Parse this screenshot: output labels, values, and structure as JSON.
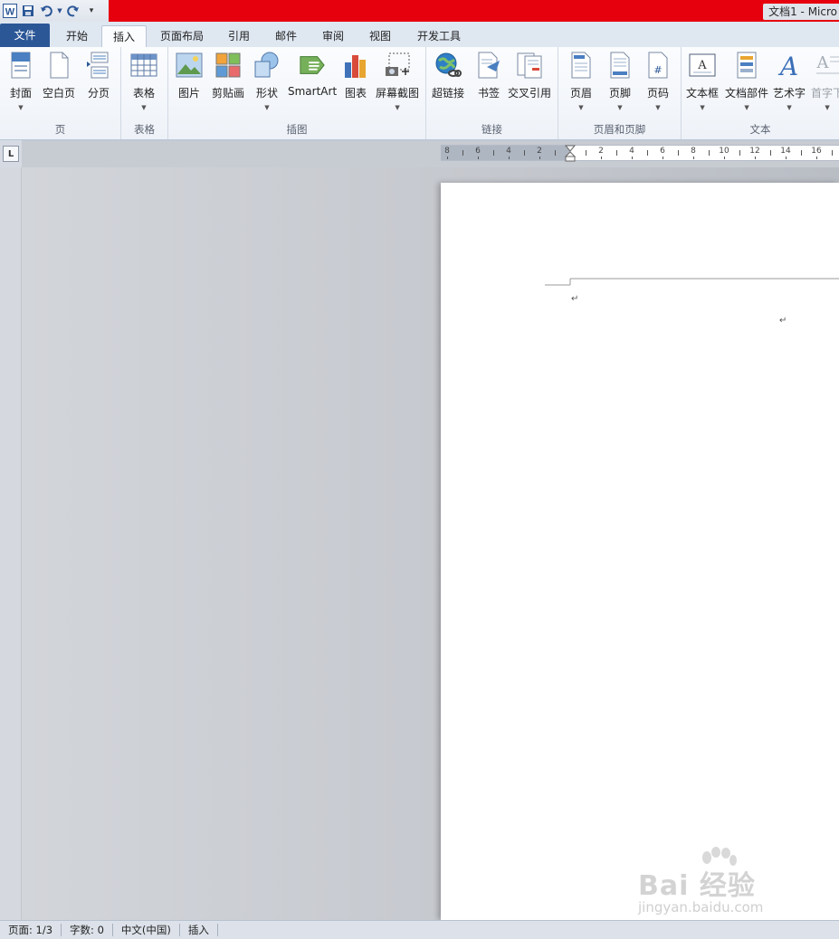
{
  "titlebar": {
    "document_title": "文档1 - Micro"
  },
  "tabs": {
    "file": "文件",
    "home": "开始",
    "insert": "插入",
    "page_layout": "页面布局",
    "references": "引用",
    "mailings": "邮件",
    "review": "审阅",
    "view": "视图",
    "developer": "开发工具"
  },
  "ribbon": {
    "pages_group": {
      "label": "页",
      "cover": "封面",
      "blank_page": "空白页",
      "page_break": "分页"
    },
    "tables_group": {
      "label": "表格",
      "table": "表格"
    },
    "illustrations_group": {
      "label": "插图",
      "picture": "图片",
      "clip_art": "剪贴画",
      "shapes": "形状",
      "smartart": "SmartArt",
      "chart": "图表",
      "screenshot": "屏幕截图"
    },
    "links_group": {
      "label": "链接",
      "hyperlink": "超链接",
      "bookmark": "书签",
      "cross_reference": "交叉引用"
    },
    "header_footer_group": {
      "label": "页眉和页脚",
      "header": "页眉",
      "footer": "页脚",
      "page_number": "页码"
    },
    "text_group": {
      "label": "文本",
      "text_box": "文本框",
      "quick_parts": "文档部件",
      "wordart": "艺术字",
      "drop_cap": "首字下"
    }
  },
  "ruler": {
    "ticks": [
      "8",
      "6",
      "4",
      "2",
      "2",
      "4",
      "6",
      "8",
      "10",
      "12",
      "14",
      "16"
    ]
  },
  "document": {
    "paragraph_mark": "↵"
  },
  "statusbar": {
    "page": "页面: 1/3",
    "word_count": "字数: 0",
    "language": "中文(中国)",
    "mode": "插入"
  },
  "watermark": {
    "logo": "Bai 经验",
    "url": "jingyan.baidu.com"
  },
  "colors": {
    "accent_red": "#e6000d",
    "file_tab_blue": "#2b5797"
  }
}
